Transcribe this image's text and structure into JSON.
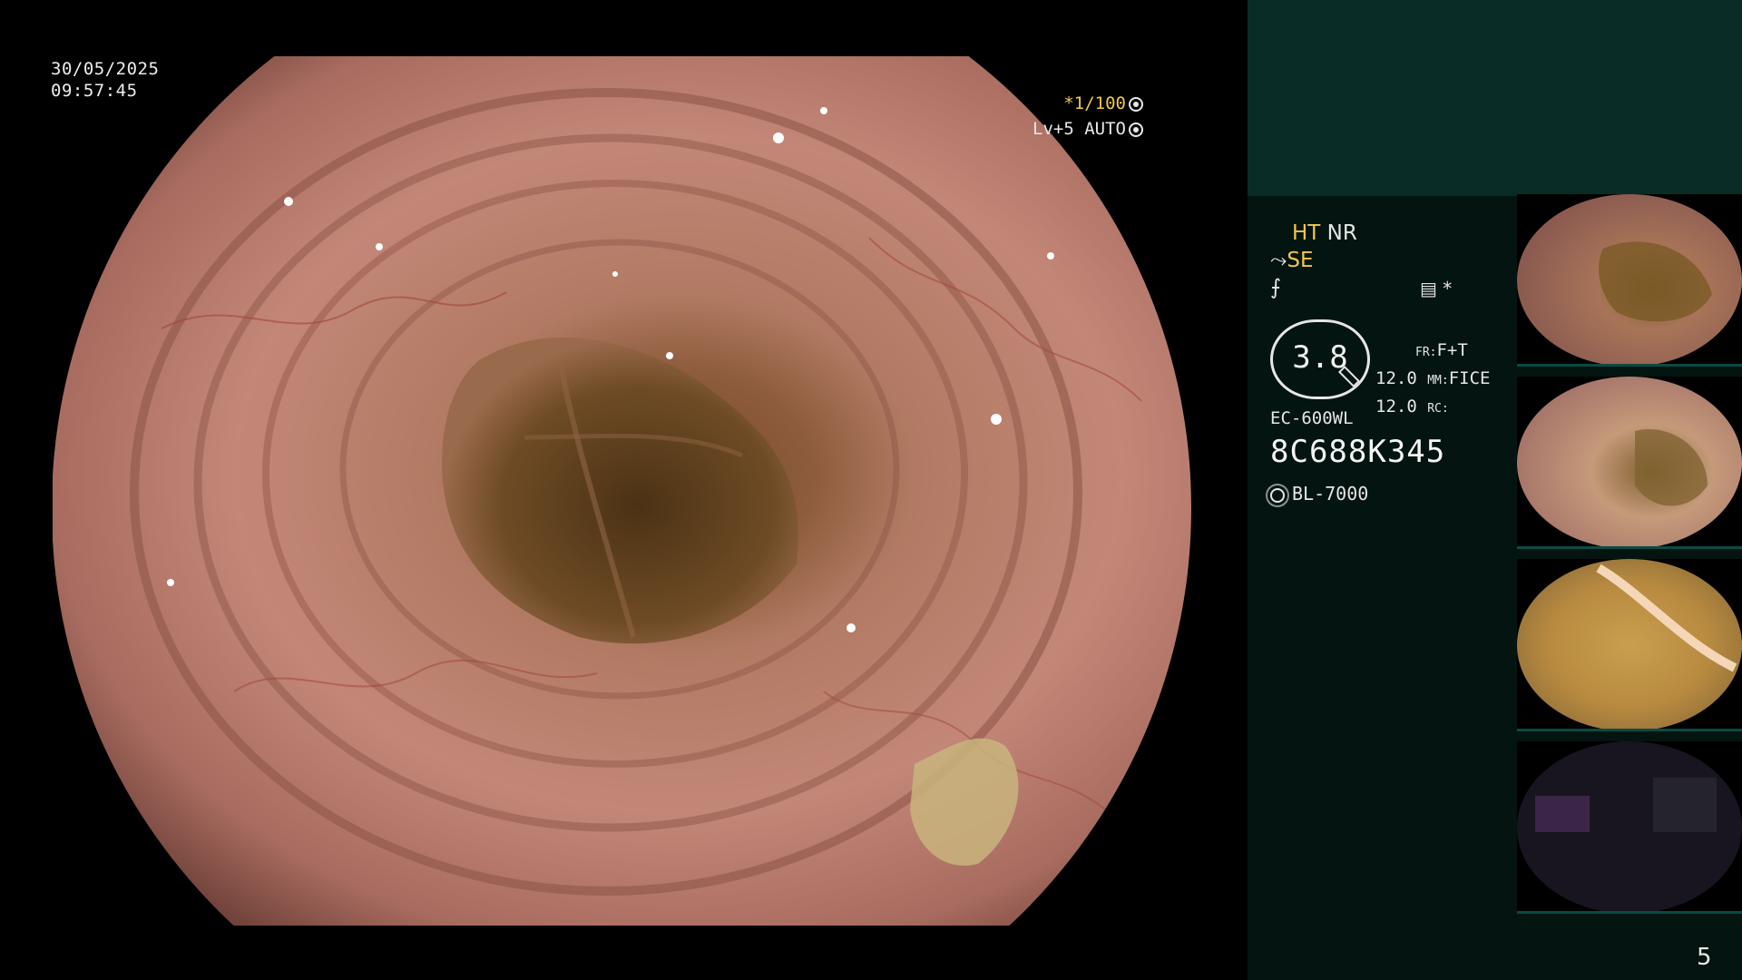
{
  "osd": {
    "date": "30/05/2025",
    "time": "09:57:45",
    "shutter": "*1/100",
    "level": "Lv+5 AUTO"
  },
  "panel": {
    "ht": "HT",
    "nr": "NR",
    "se": "SE",
    "zoom": "3.8",
    "fr_label": "FR:",
    "fr_value": "F+T",
    "mm_value_left": "12.0",
    "mm_label": "MM:",
    "mm_value": "FICE",
    "rc_value_left": "12.0",
    "rc_label": "RC:",
    "scope_model": "EC-600WL",
    "scope_serial": "8C688K345",
    "light_source": "BL-7000",
    "tool_star": "*"
  },
  "page_number": "5",
  "colors": {
    "panel_bg": "#041410",
    "panel_top": "#0a2c27",
    "accent": "#f1c84a",
    "mucosa": "#b87a6c"
  },
  "icons": [
    "shutter-icon",
    "iris-icon",
    "scope-icon",
    "bend-icon",
    "record-icon",
    "magnifier-icon",
    "light-source-icon"
  ]
}
